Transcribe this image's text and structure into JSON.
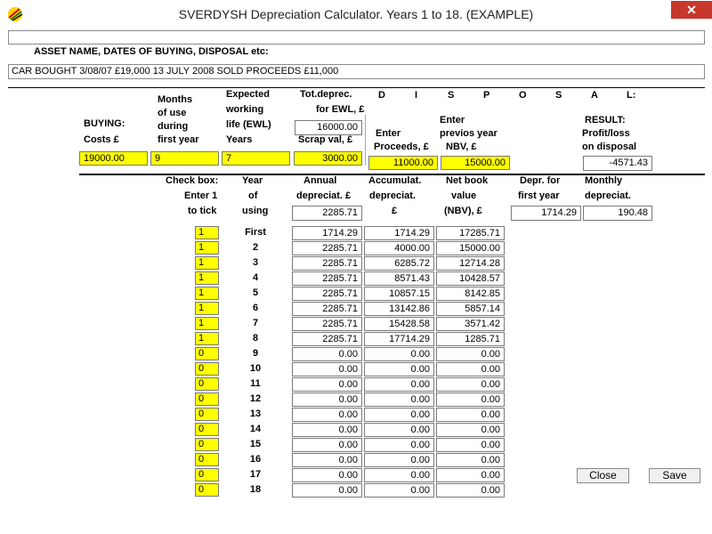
{
  "window": {
    "title": "SVERDYSH Depreciation Calculator. Years 1 to 18. (EXAMPLE)",
    "close_glyph": "✕"
  },
  "top_input": {
    "value": ""
  },
  "asset": {
    "label": "ASSET NAME, DATES OF BUYING, DISPOSAL etc:",
    "value": "CAR     BOUGHT  3/08/07  £19,000          13 JULY 2008  SOLD PROCEEDS £11,000"
  },
  "buying": {
    "costs_label_line1": "BUYING:",
    "costs_label_line2": "Costs £",
    "costs_value": "19000.00",
    "months_label": [
      "Months",
      "of use",
      "during",
      "first year"
    ],
    "months_value": "9",
    "ewl_label": [
      "Expected",
      "working",
      "life (EWL)",
      "Years"
    ],
    "ewl_value": "7",
    "totdep_label": [
      "Tot.deprec.",
      "for EWL, £"
    ],
    "totdep_value": "16000.00",
    "scrap_label": "Scrap val, £",
    "scrap_value": "3000.00"
  },
  "disposal": {
    "letters": [
      "D",
      "I",
      "S",
      "P",
      "O",
      "S",
      "A",
      "L:"
    ],
    "proceeds_label": [
      "Enter",
      "Proceeds, £"
    ],
    "proceeds_value": "11000.00",
    "nbv_label": [
      "Enter",
      "previos year",
      "NBV, £"
    ],
    "nbv_value": "15000.00",
    "result_label": [
      "RESULT:",
      "Profit/loss",
      "on disposal"
    ],
    "result_value": "-4571.43"
  },
  "headers": {
    "checkbox": [
      "Check box:",
      "Enter 1",
      "to tick"
    ],
    "year": [
      "Year",
      "of",
      "using"
    ],
    "annual": [
      "Annual",
      "depreciat. £"
    ],
    "annual_value": "2285.71",
    "accum": [
      "Accumulat.",
      "depreciat.",
      "£"
    ],
    "nbv": [
      "Net book",
      "value",
      "(NBV), £"
    ],
    "first_year": [
      "Depr. for",
      "first year"
    ],
    "first_year_value": "1714.29",
    "monthly": [
      "Monthly",
      "depreciat."
    ],
    "monthly_value": "190.48"
  },
  "rows": [
    {
      "tick": "1",
      "year": "First",
      "annual": "1714.29",
      "accum": "1714.29",
      "nbv": "17285.71"
    },
    {
      "tick": "1",
      "year": "2",
      "annual": "2285.71",
      "accum": "4000.00",
      "nbv": "15000.00"
    },
    {
      "tick": "1",
      "year": "3",
      "annual": "2285.71",
      "accum": "6285.72",
      "nbv": "12714.28"
    },
    {
      "tick": "1",
      "year": "4",
      "annual": "2285.71",
      "accum": "8571.43",
      "nbv": "10428.57"
    },
    {
      "tick": "1",
      "year": "5",
      "annual": "2285.71",
      "accum": "10857.15",
      "nbv": "8142.85"
    },
    {
      "tick": "1",
      "year": "6",
      "annual": "2285.71",
      "accum": "13142.86",
      "nbv": "5857.14"
    },
    {
      "tick": "1",
      "year": "7",
      "annual": "2285.71",
      "accum": "15428.58",
      "nbv": "3571.42"
    },
    {
      "tick": "1",
      "year": "8",
      "annual": "2285.71",
      "accum": "17714.29",
      "nbv": "1285.71"
    },
    {
      "tick": "0",
      "year": "9",
      "annual": "0.00",
      "accum": "0.00",
      "nbv": "0.00"
    },
    {
      "tick": "0",
      "year": "10",
      "annual": "0.00",
      "accum": "0.00",
      "nbv": "0.00"
    },
    {
      "tick": "0",
      "year": "11",
      "annual": "0.00",
      "accum": "0.00",
      "nbv": "0.00"
    },
    {
      "tick": "0",
      "year": "12",
      "annual": "0.00",
      "accum": "0.00",
      "nbv": "0.00"
    },
    {
      "tick": "0",
      "year": "13",
      "annual": "0.00",
      "accum": "0.00",
      "nbv": "0.00"
    },
    {
      "tick": "0",
      "year": "14",
      "annual": "0.00",
      "accum": "0.00",
      "nbv": "0.00"
    },
    {
      "tick": "0",
      "year": "15",
      "annual": "0.00",
      "accum": "0.00",
      "nbv": "0.00"
    },
    {
      "tick": "0",
      "year": "16",
      "annual": "0.00",
      "accum": "0.00",
      "nbv": "0.00"
    },
    {
      "tick": "0",
      "year": "17",
      "annual": "0.00",
      "accum": "0.00",
      "nbv": "0.00"
    },
    {
      "tick": "0",
      "year": "18",
      "annual": "0.00",
      "accum": "0.00",
      "nbv": "0.00"
    }
  ],
  "buttons": {
    "close": "Close",
    "save": "Save"
  },
  "colors": {
    "input_yellow": "#ffff00",
    "close_red": "#c7372c"
  }
}
